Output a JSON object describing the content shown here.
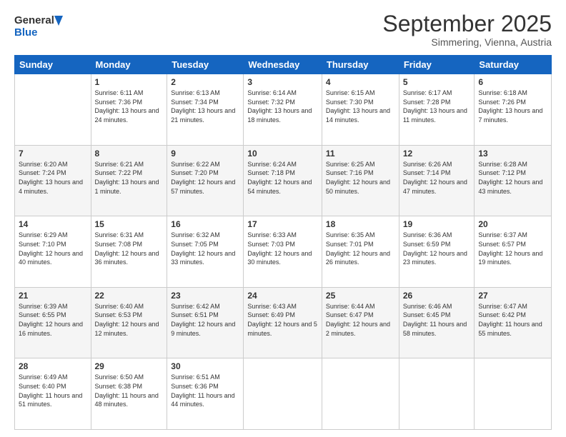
{
  "logo": {
    "line1": "General",
    "line2": "Blue"
  },
  "title": "September 2025",
  "location": "Simmering, Vienna, Austria",
  "days_header": [
    "Sunday",
    "Monday",
    "Tuesday",
    "Wednesday",
    "Thursday",
    "Friday",
    "Saturday"
  ],
  "weeks": [
    [
      {
        "day": "",
        "info": ""
      },
      {
        "day": "1",
        "info": "Sunrise: 6:11 AM\nSunset: 7:36 PM\nDaylight: 13 hours and 24 minutes."
      },
      {
        "day": "2",
        "info": "Sunrise: 6:13 AM\nSunset: 7:34 PM\nDaylight: 13 hours and 21 minutes."
      },
      {
        "day": "3",
        "info": "Sunrise: 6:14 AM\nSunset: 7:32 PM\nDaylight: 13 hours and 18 minutes."
      },
      {
        "day": "4",
        "info": "Sunrise: 6:15 AM\nSunset: 7:30 PM\nDaylight: 13 hours and 14 minutes."
      },
      {
        "day": "5",
        "info": "Sunrise: 6:17 AM\nSunset: 7:28 PM\nDaylight: 13 hours and 11 minutes."
      },
      {
        "day": "6",
        "info": "Sunrise: 6:18 AM\nSunset: 7:26 PM\nDaylight: 13 hours and 7 minutes."
      }
    ],
    [
      {
        "day": "7",
        "info": "Sunrise: 6:20 AM\nSunset: 7:24 PM\nDaylight: 13 hours and 4 minutes."
      },
      {
        "day": "8",
        "info": "Sunrise: 6:21 AM\nSunset: 7:22 PM\nDaylight: 13 hours and 1 minute."
      },
      {
        "day": "9",
        "info": "Sunrise: 6:22 AM\nSunset: 7:20 PM\nDaylight: 12 hours and 57 minutes."
      },
      {
        "day": "10",
        "info": "Sunrise: 6:24 AM\nSunset: 7:18 PM\nDaylight: 12 hours and 54 minutes."
      },
      {
        "day": "11",
        "info": "Sunrise: 6:25 AM\nSunset: 7:16 PM\nDaylight: 12 hours and 50 minutes."
      },
      {
        "day": "12",
        "info": "Sunrise: 6:26 AM\nSunset: 7:14 PM\nDaylight: 12 hours and 47 minutes."
      },
      {
        "day": "13",
        "info": "Sunrise: 6:28 AM\nSunset: 7:12 PM\nDaylight: 12 hours and 43 minutes."
      }
    ],
    [
      {
        "day": "14",
        "info": "Sunrise: 6:29 AM\nSunset: 7:10 PM\nDaylight: 12 hours and 40 minutes."
      },
      {
        "day": "15",
        "info": "Sunrise: 6:31 AM\nSunset: 7:08 PM\nDaylight: 12 hours and 36 minutes."
      },
      {
        "day": "16",
        "info": "Sunrise: 6:32 AM\nSunset: 7:05 PM\nDaylight: 12 hours and 33 minutes."
      },
      {
        "day": "17",
        "info": "Sunrise: 6:33 AM\nSunset: 7:03 PM\nDaylight: 12 hours and 30 minutes."
      },
      {
        "day": "18",
        "info": "Sunrise: 6:35 AM\nSunset: 7:01 PM\nDaylight: 12 hours and 26 minutes."
      },
      {
        "day": "19",
        "info": "Sunrise: 6:36 AM\nSunset: 6:59 PM\nDaylight: 12 hours and 23 minutes."
      },
      {
        "day": "20",
        "info": "Sunrise: 6:37 AM\nSunset: 6:57 PM\nDaylight: 12 hours and 19 minutes."
      }
    ],
    [
      {
        "day": "21",
        "info": "Sunrise: 6:39 AM\nSunset: 6:55 PM\nDaylight: 12 hours and 16 minutes."
      },
      {
        "day": "22",
        "info": "Sunrise: 6:40 AM\nSunset: 6:53 PM\nDaylight: 12 hours and 12 minutes."
      },
      {
        "day": "23",
        "info": "Sunrise: 6:42 AM\nSunset: 6:51 PM\nDaylight: 12 hours and 9 minutes."
      },
      {
        "day": "24",
        "info": "Sunrise: 6:43 AM\nSunset: 6:49 PM\nDaylight: 12 hours and 5 minutes."
      },
      {
        "day": "25",
        "info": "Sunrise: 6:44 AM\nSunset: 6:47 PM\nDaylight: 12 hours and 2 minutes."
      },
      {
        "day": "26",
        "info": "Sunrise: 6:46 AM\nSunset: 6:45 PM\nDaylight: 11 hours and 58 minutes."
      },
      {
        "day": "27",
        "info": "Sunrise: 6:47 AM\nSunset: 6:42 PM\nDaylight: 11 hours and 55 minutes."
      }
    ],
    [
      {
        "day": "28",
        "info": "Sunrise: 6:49 AM\nSunset: 6:40 PM\nDaylight: 11 hours and 51 minutes."
      },
      {
        "day": "29",
        "info": "Sunrise: 6:50 AM\nSunset: 6:38 PM\nDaylight: 11 hours and 48 minutes."
      },
      {
        "day": "30",
        "info": "Sunrise: 6:51 AM\nSunset: 6:36 PM\nDaylight: 11 hours and 44 minutes."
      },
      {
        "day": "",
        "info": ""
      },
      {
        "day": "",
        "info": ""
      },
      {
        "day": "",
        "info": ""
      },
      {
        "day": "",
        "info": ""
      }
    ]
  ]
}
